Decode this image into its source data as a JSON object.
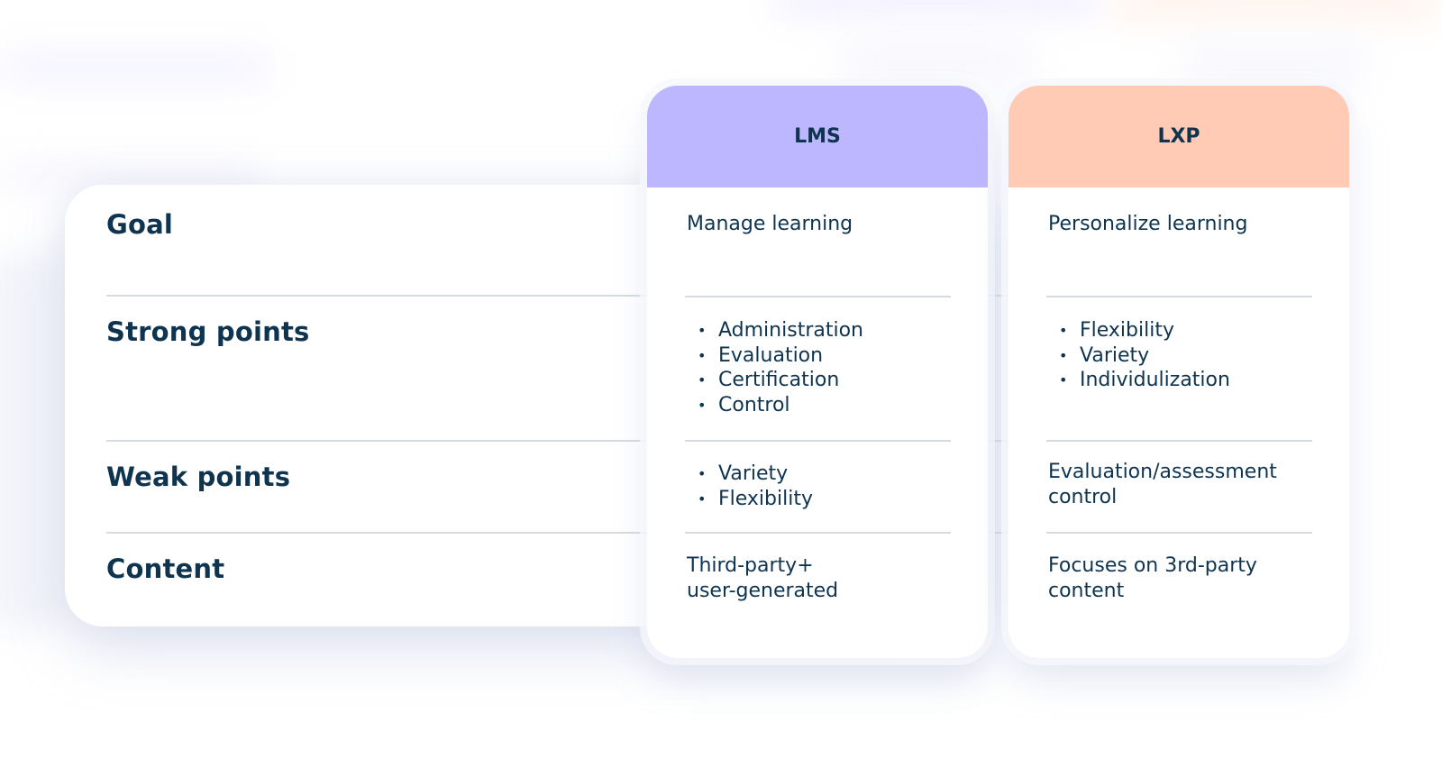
{
  "colors": {
    "text": "#0e3450",
    "lms_header": "#bdb7ff",
    "lxp_header": "#ffcbb5",
    "divider": "#d5dbe1",
    "card": "#ffffff"
  },
  "rows": [
    {
      "label": "Goal"
    },
    {
      "label": "Strong points"
    },
    {
      "label": "Weak points"
    },
    {
      "label": "Content"
    }
  ],
  "columns": [
    {
      "title": "LMS",
      "goal": "Manage learning",
      "strong_points": [
        "Administration",
        "Evaluation",
        "Certification",
        "Control"
      ],
      "weak_points": [
        "Variety",
        "Flexibility"
      ],
      "content": [
        "Third-party+",
        "user-generated"
      ]
    },
    {
      "title": "LXP",
      "goal": "Personalize learning",
      "strong_points": [
        "Flexibility",
        "Variety",
        "Individulization"
      ],
      "weak_points_text": [
        "Evaluation/assessment",
        "control"
      ],
      "content": [
        "Focuses on 3rd-party",
        "content"
      ]
    }
  ]
}
